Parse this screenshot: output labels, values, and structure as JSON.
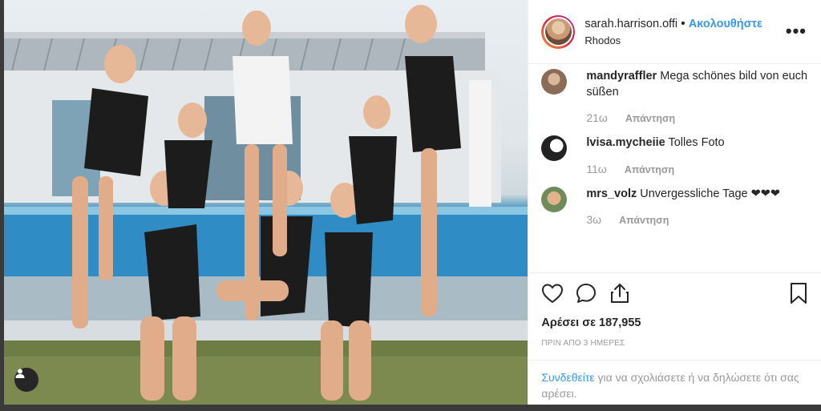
{
  "post": {
    "username": "sarah.harrison.offi",
    "separator": "•",
    "follow_label": "Ακολουθήστε",
    "location": "Rhodos",
    "more_icon": "more-horizontal-icon"
  },
  "comments": [
    {
      "user": "mandyraffler",
      "text": "Mega schönes bild von euch süßen",
      "time": "21ω",
      "reply": "Απάντηση"
    },
    {
      "user": "lvisa.mycheiie",
      "text": "Tolles Foto",
      "time": "11ω",
      "reply": "Απάντηση"
    },
    {
      "user": "mrs_volz",
      "text": "Unvergessliche Tage ❤❤❤",
      "time": "3ω",
      "reply": "Απάντηση"
    }
  ],
  "actions": {
    "like_icon": "heart-icon",
    "comment_icon": "comment-icon",
    "share_icon": "share-icon",
    "save_icon": "bookmark-icon"
  },
  "likes": "Αρέσει σε 187,955",
  "timestamp": "ΠΡΙΝ ΑΠΟ 3 ΗΜΕΡΕΣ",
  "login": {
    "link": "Συνδεθείτε",
    "rest": " για να σχολιάσετε ή να δηλώσετε ότι σας αρέσει."
  },
  "colors": {
    "link": "#3897f0",
    "text": "#262626",
    "muted": "#999999"
  }
}
